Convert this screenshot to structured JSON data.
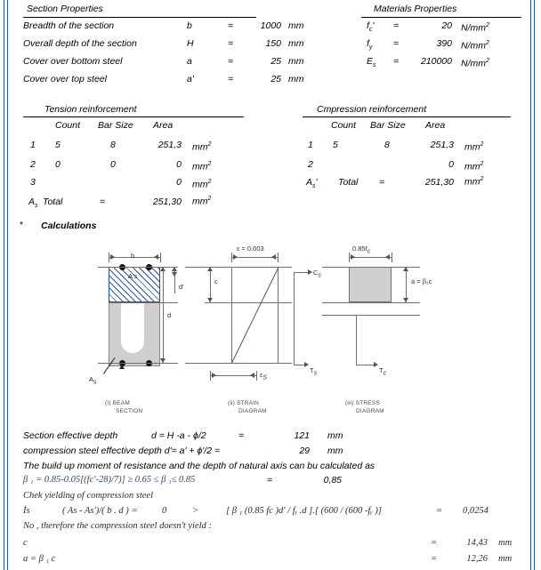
{
  "section_properties": {
    "title": "Section Properties",
    "rows": [
      {
        "label": "Breadth of the section",
        "sym": "b",
        "eq": "=",
        "value": "1000",
        "unit": "mm"
      },
      {
        "label": "Overall depth of the section",
        "sym": "H",
        "eq": "=",
        "value": "150",
        "unit": "mm"
      },
      {
        "label": "Cover over bottom steel",
        "sym": "a",
        "eq": "=",
        "value": "25",
        "unit": "mm"
      },
      {
        "label": "Cover over top steel",
        "sym": "a'",
        "eq": "=",
        "value": "25",
        "unit": "mm"
      }
    ]
  },
  "materials_properties": {
    "title": "Materials Properties",
    "rows": [
      {
        "sym": "f",
        "sub": "c",
        "prime": "'",
        "eq": "=",
        "value": "20",
        "unit": "N/mm",
        "sup": "2"
      },
      {
        "sym": "f",
        "sub": "y",
        "prime": "",
        "eq": "=",
        "value": "390",
        "unit": "N/mm",
        "sup": "2"
      },
      {
        "sym": "E",
        "sub": "s",
        "prime": "",
        "eq": "=",
        "value": "210000",
        "unit": "N/mm",
        "sup": "2"
      }
    ]
  },
  "tension_reinforcement": {
    "title": "Tension reinforcement",
    "columns": [
      "Count",
      "Bar Size",
      "Area"
    ],
    "rows": [
      {
        "no": "1",
        "count": "5",
        "bar_size": "8",
        "area": "251,3",
        "unit": "mm",
        "sup": "2"
      },
      {
        "no": "2",
        "count": "0",
        "bar_size": "0",
        "area": "0",
        "unit": "mm",
        "sup": "2"
      },
      {
        "no": "3",
        "count": "",
        "bar_size": "",
        "area": "0",
        "unit": "mm",
        "sup": "2"
      }
    ],
    "total_label": "A",
    "total_sub": "s",
    "total_word": "Total",
    "total_eq": "=",
    "total_value": "251,30",
    "total_unit": "mm",
    "total_sup": "2"
  },
  "compression_reinforcement": {
    "title": "Cmpression reinforcement",
    "columns": [
      "Count",
      "Bar Size",
      "Area"
    ],
    "rows": [
      {
        "no": "1",
        "count": "5",
        "bar_size": "8",
        "area": "251,3",
        "unit": "mm",
        "sup": "2"
      },
      {
        "no": "2",
        "count": "",
        "bar_size": "",
        "area": "0",
        "unit": "mm",
        "sup": "2"
      }
    ],
    "total_label": "A",
    "total_sub": "s",
    "total_prime": "'",
    "total_word": "Total",
    "total_eq": "=",
    "total_value": "251,30",
    "total_unit": "mm",
    "total_sup": "2"
  },
  "calculations": {
    "bullet": "*",
    "heading": "Calculations",
    "lines": [
      {
        "label": "Section effective depth",
        "expr": "d = H -a -  ϕ/2",
        "eq": "=",
        "value": "121",
        "unit": "mm"
      },
      {
        "label": "compression steel effective depth d'= a' + ϕ'/2 =",
        "expr": "",
        "eq": "",
        "value": "29",
        "unit": "mm"
      }
    ],
    "note1": "The build up moment of resistance and the depth of natural axis can bu calculated as",
    "beta_formula": "β ₁ = 0.85-0.05[(fc'-28)/7)] ≥ 0.65 ≤   β ₁≤ 0.85",
    "beta_eq": "=",
    "beta_value": "0,85",
    "check_line": "Chek yielding of compression steel",
    "is_label": "İs",
    "is_expr": "( As - As')/( b . d ) =",
    "is_value": "0",
    "is_gt": ">",
    "is_rhs": "[ β ₁ (0.85 fс )d' / fᵧ .d ].[ (600 / (600 -fᵧ )]",
    "is_eq": "=",
    "is_result": "0,0254",
    "no_yield": "No , therefore the compression steel doesn't yield :",
    "c_label": "c",
    "c_eq": "=",
    "c_value": "14,43",
    "c_unit": "mm",
    "a_label": "a =  β ₁ c",
    "a_eq": "=",
    "a_value": "12,26",
    "a_unit": "mm"
  },
  "diagram": {
    "beam": {
      "b_label": "b",
      "as_prime_label": "A's",
      "as_label": "A",
      "as_sub": "s",
      "d_prime_label": "d'",
      "d_label": "d",
      "caption1": "(I) BEAM",
      "caption2": "SECTION"
    },
    "strain": {
      "eps_top": "ε = 0.003",
      "c_label": "c",
      "eps_s": "ε",
      "eps_s_sub": "S",
      "caption1": "(ii) STRAIN",
      "caption2": "DIAGRAM"
    },
    "stress": {
      "fc_label": "0.85f",
      "fc_sub": "c",
      "a_beta_label": "a = β₁c",
      "cs_label": "C",
      "cs_sub": "s",
      "ts_label": "T",
      "ts_sub": "s",
      "tc_label": "T",
      "tc_sub": "c",
      "caption1": "(iii) STRESS",
      "caption2": "DIAGRAM"
    }
  },
  "colors": {
    "border_blue": "#2e5395",
    "hatch_blue": "#2e5395",
    "concrete_grey": "#cfcfcf",
    "line_grey": "#6e6e6e"
  }
}
